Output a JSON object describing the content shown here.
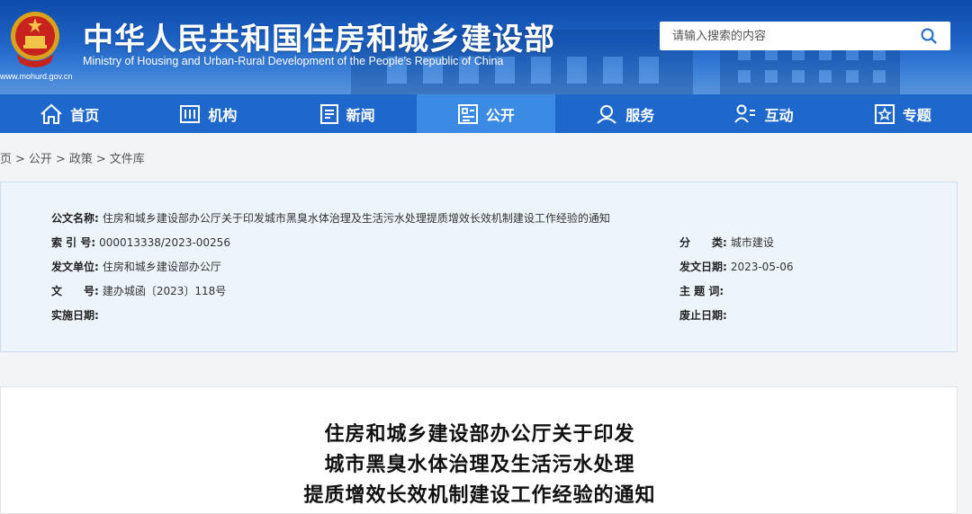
{
  "header": {
    "site_url": "www.mohurd.gov.cn",
    "title": "中华人民共和国住房和城乡建设部",
    "subtitle": "Ministry of Housing and Urban-Rural Development of the People’s Republic of China",
    "search_placeholder": "请输入搜索的内容",
    "search_icon": "search-icon",
    "brand_color": "#1f68cb",
    "active_color": "#3b8ae3"
  },
  "nav": {
    "items": [
      {
        "label": "首页",
        "icon": "home-icon"
      },
      {
        "label": "机构",
        "icon": "building-icon"
      },
      {
        "label": "新闻",
        "icon": "news-icon"
      },
      {
        "label": "公开",
        "icon": "open-icon",
        "active": true
      },
      {
        "label": "服务",
        "icon": "service-icon"
      },
      {
        "label": "互动",
        "icon": "interact-icon"
      },
      {
        "label": "专题",
        "icon": "topic-icon"
      }
    ]
  },
  "breadcrumb": {
    "items": [
      "页",
      "公开",
      "政策",
      "文件库"
    ],
    "separator": ">"
  },
  "doc_info": {
    "name_label": "公文名称:",
    "name_value": "住房和城乡建设部办公厅关于印发城市黑臭水体治理及生活污水处理提质增效长效机制建设工作经验的通知",
    "index_label": "索 引 号:",
    "index_value": "000013338/2023-00256",
    "category_label": "分　　类:",
    "category_value": "城市建设",
    "issuer_label": "发文单位:",
    "issuer_value": "住房和城乡建设部办公厅",
    "date_label": "发文日期:",
    "date_value": "2023-05-06",
    "docno_label": "文　　号:",
    "docno_value": "建办城函〔2023〕118号",
    "subject_label": "主 题 词:",
    "subject_value": "",
    "effective_label": "实施日期:",
    "effective_value": "",
    "repeal_label": "废止日期:",
    "repeal_value": ""
  },
  "article": {
    "title_lines": [
      "住房和城乡建设部办公厅关于印发",
      "城市黑臭水体治理及生活污水处理",
      "提质增效长效机制建设工作经验的通知"
    ]
  }
}
